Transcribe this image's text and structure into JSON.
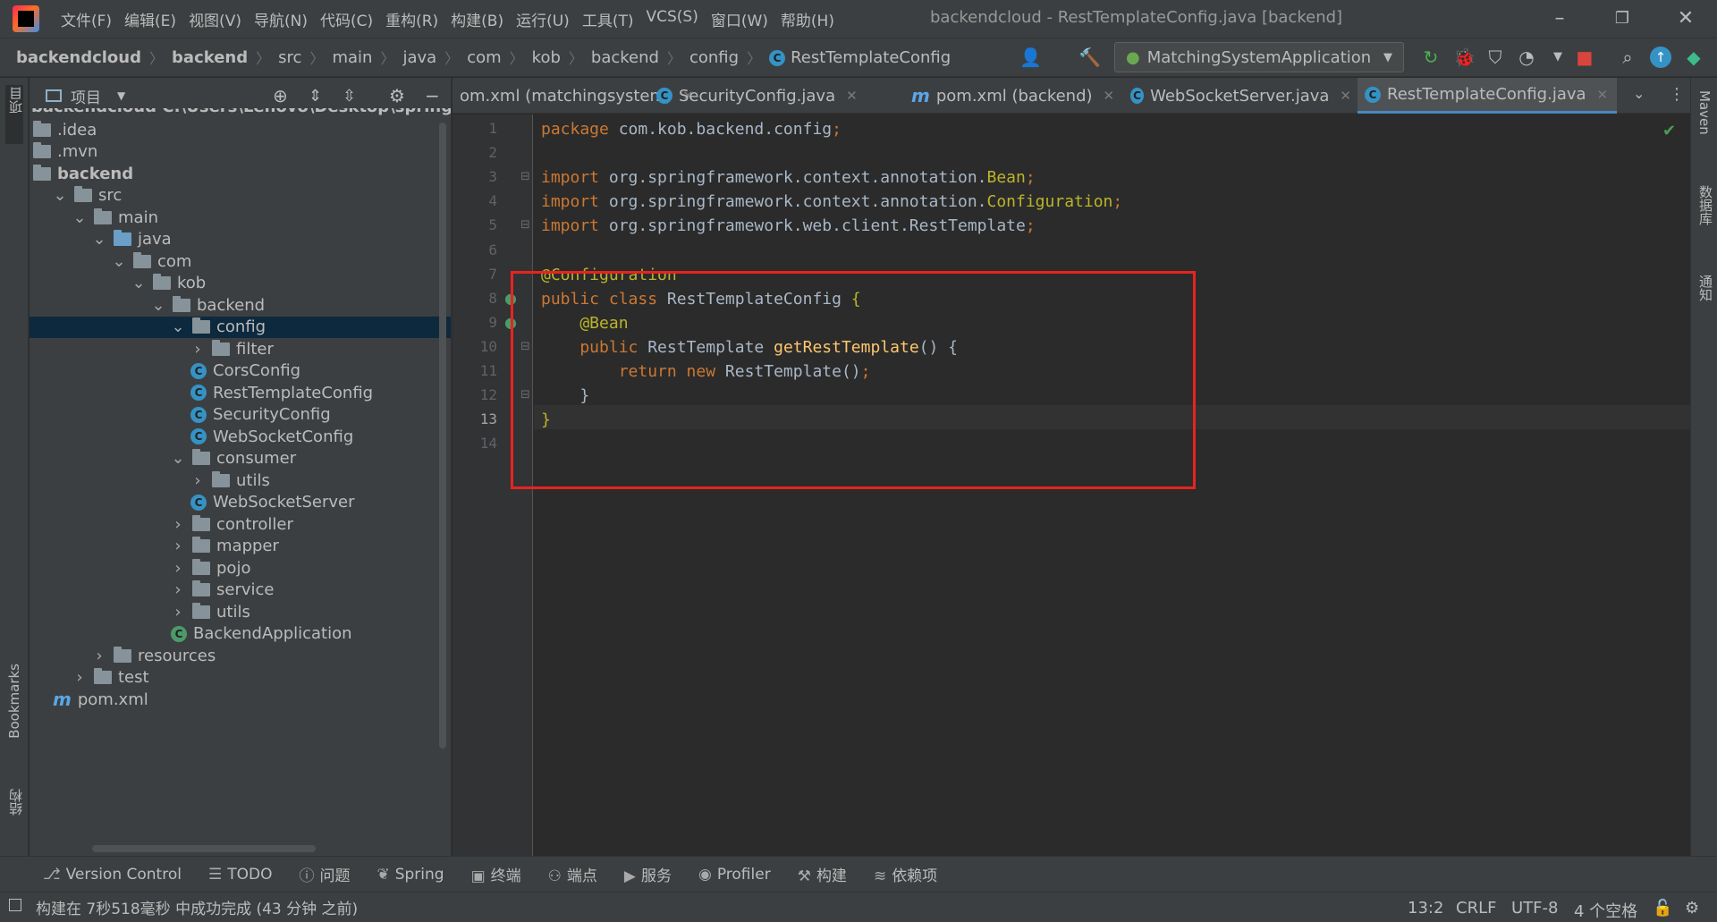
{
  "titlebar": {
    "menus": [
      "文件(F)",
      "编辑(E)",
      "视图(V)",
      "导航(N)",
      "代码(C)",
      "重构(R)",
      "构建(B)",
      "运行(U)",
      "工具(T)",
      "VCS(S)",
      "窗口(W)",
      "帮助(H)"
    ],
    "window_title": "backendcloud - RestTemplateConfig.java [backend]"
  },
  "navbar": {
    "breadcrumbs": [
      "backendcloud",
      "backend",
      "src",
      "main",
      "java",
      "com",
      "kob",
      "backend",
      "config",
      "RestTemplateConfig"
    ],
    "run_config": "MatchingSystemApplication"
  },
  "left_strip": {
    "project": "项目",
    "bookmarks": "Bookmarks",
    "structure": "结构"
  },
  "right_strip": {
    "maven": "Maven",
    "database": "数据库",
    "notifications": "通知"
  },
  "project_panel": {
    "title": "项目",
    "root_partial": "backendcloud C:\\Users\\Lenovo\\Desktop\\springboot\\",
    "tree": [
      {
        "label": ".idea",
        "indent": 0,
        "arrow": "",
        "icon": "folder"
      },
      {
        "label": ".mvn",
        "indent": 0,
        "arrow": "",
        "icon": "folder"
      },
      {
        "label": "backend",
        "indent": 0,
        "arrow": "",
        "icon": "folder",
        "bold": true
      },
      {
        "label": "src",
        "indent": 1,
        "arrow": "down",
        "icon": "folder"
      },
      {
        "label": "main",
        "indent": 2,
        "arrow": "down",
        "icon": "folder"
      },
      {
        "label": "java",
        "indent": 3,
        "arrow": "down",
        "icon": "folder-blue"
      },
      {
        "label": "com",
        "indent": 4,
        "arrow": "down",
        "icon": "folder"
      },
      {
        "label": "kob",
        "indent": 5,
        "arrow": "down",
        "icon": "folder"
      },
      {
        "label": "backend",
        "indent": 6,
        "arrow": "down",
        "icon": "folder"
      },
      {
        "label": "config",
        "indent": 7,
        "arrow": "down",
        "icon": "folder",
        "selected": true
      },
      {
        "label": "filter",
        "indent": 8,
        "arrow": "right",
        "icon": "folder"
      },
      {
        "label": "CorsConfig",
        "indent": 8,
        "arrow": "",
        "icon": "class"
      },
      {
        "label": "RestTemplateConfig",
        "indent": 8,
        "arrow": "",
        "icon": "class"
      },
      {
        "label": "SecurityConfig",
        "indent": 8,
        "arrow": "",
        "icon": "class"
      },
      {
        "label": "WebSocketConfig",
        "indent": 8,
        "arrow": "",
        "icon": "class"
      },
      {
        "label": "consumer",
        "indent": 7,
        "arrow": "down",
        "icon": "folder"
      },
      {
        "label": "utils",
        "indent": 8,
        "arrow": "right",
        "icon": "folder"
      },
      {
        "label": "WebSocketServer",
        "indent": 8,
        "arrow": "",
        "icon": "class"
      },
      {
        "label": "controller",
        "indent": 7,
        "arrow": "right",
        "icon": "folder"
      },
      {
        "label": "mapper",
        "indent": 7,
        "arrow": "right",
        "icon": "folder"
      },
      {
        "label": "pojo",
        "indent": 7,
        "arrow": "right",
        "icon": "folder"
      },
      {
        "label": "service",
        "indent": 7,
        "arrow": "right",
        "icon": "folder"
      },
      {
        "label": "utils",
        "indent": 7,
        "arrow": "right",
        "icon": "folder"
      },
      {
        "label": "BackendApplication",
        "indent": 7,
        "arrow": "",
        "icon": "app"
      },
      {
        "label": "resources",
        "indent": 3,
        "arrow": "right",
        "icon": "folder"
      },
      {
        "label": "test",
        "indent": 2,
        "arrow": "right",
        "icon": "folder"
      },
      {
        "label": "pom.xml",
        "indent": 1,
        "arrow": "",
        "icon": "maven"
      }
    ]
  },
  "tabs": [
    {
      "label": "om.xml (matchingsystem)",
      "icon": "none"
    },
    {
      "label": "SecurityConfig.java",
      "icon": "class"
    },
    {
      "label": "pom.xml (backend)",
      "icon": "maven"
    },
    {
      "label": "WebSocketServer.java",
      "icon": "class"
    },
    {
      "label": "RestTemplateConfig.java",
      "icon": "class",
      "active": true
    }
  ],
  "editor": {
    "line_numbers": [
      "1",
      "2",
      "3",
      "4",
      "5",
      "6",
      "7",
      "8",
      "9",
      "10",
      "11",
      "12",
      "13",
      "14"
    ],
    "current_line": "13",
    "lines": [
      [
        {
          "t": "package ",
          "c": "kw"
        },
        {
          "t": "com.kob.backend.config",
          "c": "cls"
        },
        {
          "t": ";",
          "c": "kw"
        }
      ],
      [],
      [
        {
          "t": "import ",
          "c": "kw"
        },
        {
          "t": "org.springframework.context.annotation.",
          "c": "cls"
        },
        {
          "t": "Bean",
          "c": "ann"
        },
        {
          "t": ";",
          "c": "kw"
        }
      ],
      [
        {
          "t": "import ",
          "c": "kw"
        },
        {
          "t": "org.springframework.context.annotation.",
          "c": "cls"
        },
        {
          "t": "Configuration",
          "c": "ann"
        },
        {
          "t": ";",
          "c": "kw"
        }
      ],
      [
        {
          "t": "import ",
          "c": "kw"
        },
        {
          "t": "org.springframework.web.client.RestTemplate",
          "c": "cls"
        },
        {
          "t": ";",
          "c": "kw"
        }
      ],
      [],
      [
        {
          "t": "@Configuration",
          "c": "ann"
        }
      ],
      [
        {
          "t": "public class ",
          "c": "kw"
        },
        {
          "t": "RestTemplateConfig ",
          "c": "cls"
        },
        {
          "t": "{",
          "c": "ann"
        }
      ],
      [
        {
          "t": "    @Bean",
          "c": "ann"
        }
      ],
      [
        {
          "t": "    public ",
          "c": "kw"
        },
        {
          "t": "RestTemplate ",
          "c": "cls"
        },
        {
          "t": "getRestTemplate",
          "c": "fn"
        },
        {
          "t": "() {",
          "c": "cls"
        }
      ],
      [
        {
          "t": "        return new ",
          "c": "kw"
        },
        {
          "t": "RestTemplate()",
          "c": "cls"
        },
        {
          "t": ";",
          "c": "kw"
        }
      ],
      [
        {
          "t": "    }",
          "c": "cls"
        }
      ],
      [
        {
          "t": "}",
          "c": "ann"
        }
      ],
      []
    ]
  },
  "bottom_tools": [
    "Version Control",
    "TODO",
    "问题",
    "Spring",
    "终端",
    "端点",
    "服务",
    "Profiler",
    "构建",
    "依赖项"
  ],
  "status": {
    "message": "构建在 7秒518毫秒 中成功完成 (43 分钟 之前)",
    "position": "13:2",
    "line_sep": "CRLF",
    "encoding": "UTF-8",
    "indent": "4 个空格"
  },
  "colors": {
    "highlight_box": "#e8231f",
    "accent": "#4a88c7"
  }
}
